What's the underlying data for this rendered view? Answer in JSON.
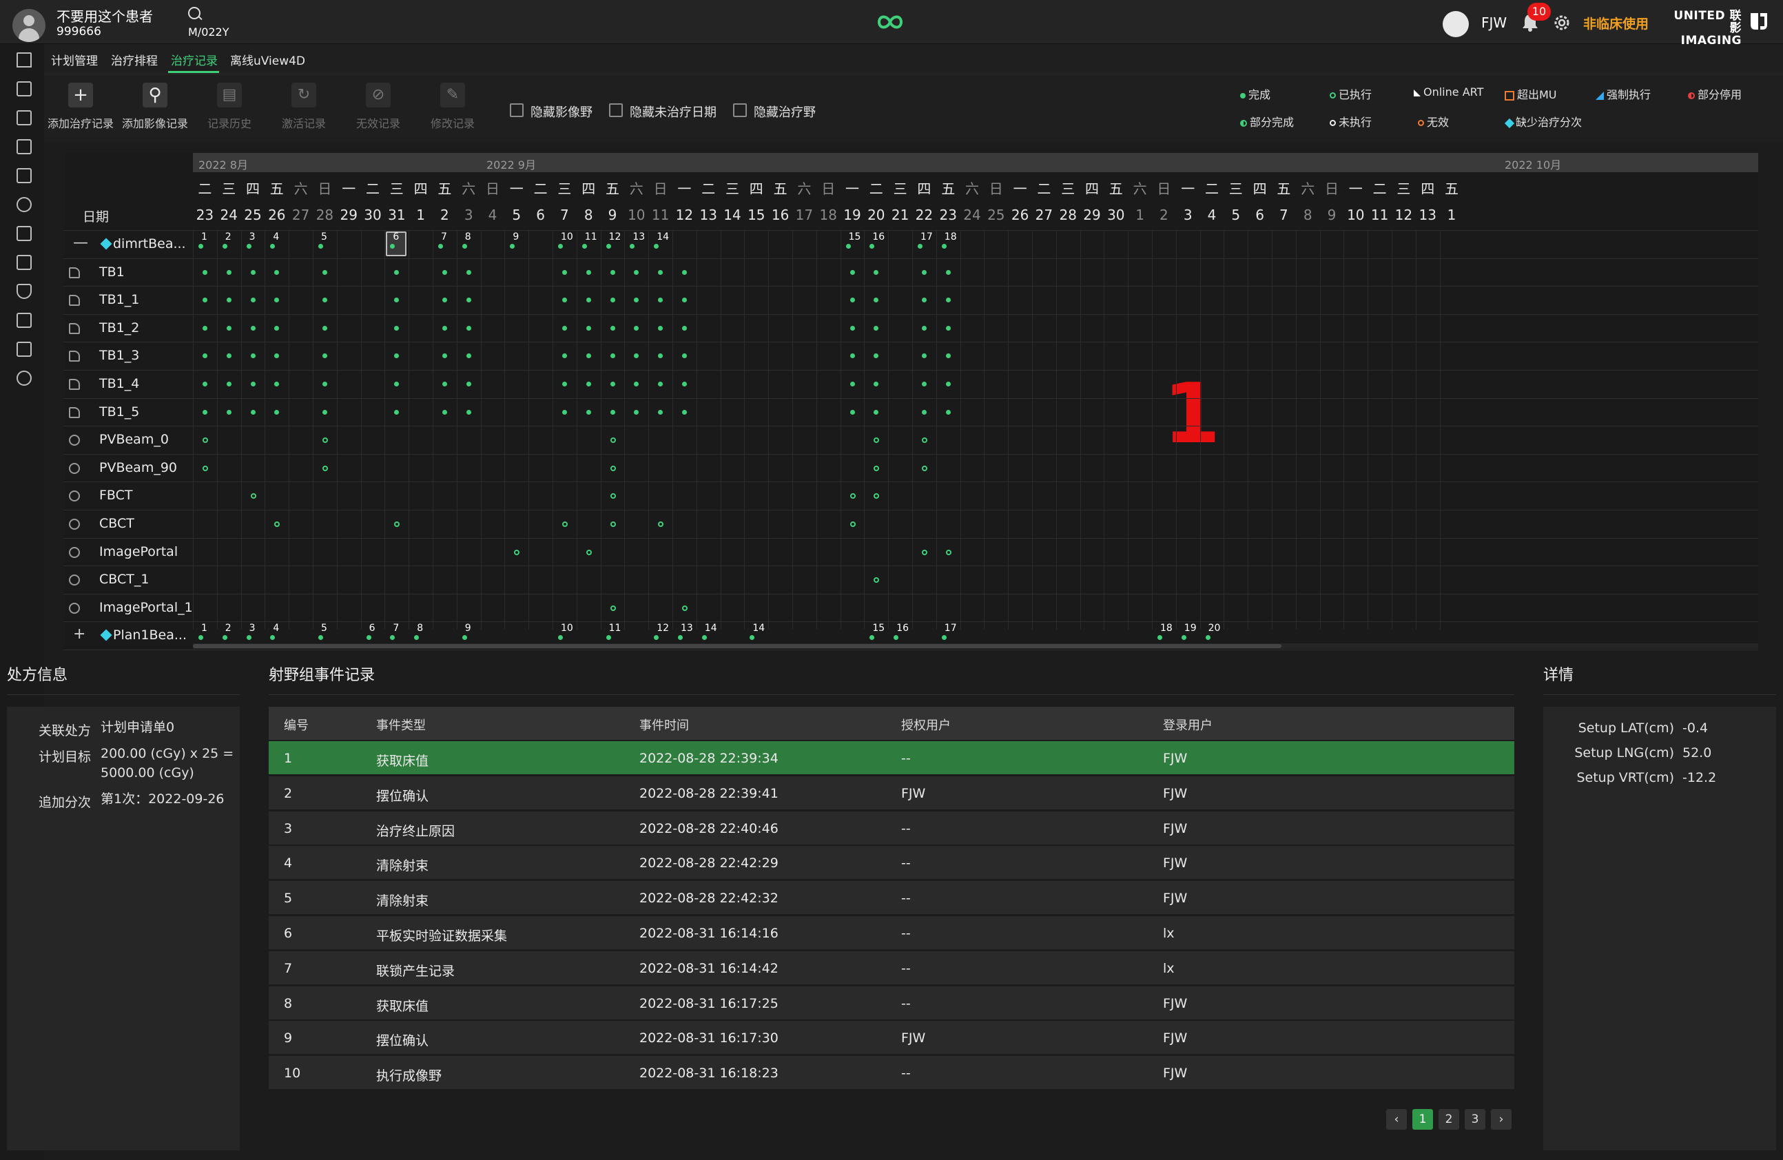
{
  "header": {
    "patient_name": "不要用这个患者",
    "patient_id": "999666",
    "patient_meta": "M/022Y",
    "user_name": "FJW",
    "notification_count": "10",
    "nonclinical_label": "非临床使用",
    "brand_line1": "UNITED 联影",
    "brand_line2": "IMAGING"
  },
  "nav_tabs": [
    {
      "label": "计划管理"
    },
    {
      "label": "治疗排程"
    },
    {
      "label": "治疗记录"
    },
    {
      "label": "离线uView4D"
    }
  ],
  "active_tab": "治疗记录",
  "toolbar": {
    "tools": [
      {
        "label": "添加治疗记录",
        "icon": "plus-icon",
        "enabled": true
      },
      {
        "label": "添加影像记录",
        "icon": "add-image-user-icon",
        "enabled": true
      },
      {
        "label": "记录历史",
        "icon": "history-icon",
        "enabled": false
      },
      {
        "label": "激活记录",
        "icon": "activate-icon",
        "enabled": false
      },
      {
        "label": "无效记录",
        "icon": "invalid-icon",
        "enabled": false
      },
      {
        "label": "修改记录",
        "icon": "edit-icon",
        "enabled": false
      }
    ],
    "checkboxes": [
      {
        "label": "隐藏影像野",
        "checked": false
      },
      {
        "label": "隐藏未治疗日期",
        "checked": false
      },
      {
        "label": "隐藏治疗野",
        "checked": false
      }
    ]
  },
  "legend": [
    {
      "label": "完成",
      "mark": "filled-dot"
    },
    {
      "label": "已执行",
      "mark": "hollow-dot"
    },
    {
      "label": "Online ART",
      "mark": "triangle-white"
    },
    {
      "label": "超出MU",
      "mark": "orange-square"
    },
    {
      "label": "强制执行",
      "mark": "blue-triangle"
    },
    {
      "label": "部分停用",
      "mark": "red-half"
    },
    {
      "label": "部分完成",
      "mark": "half-dot"
    },
    {
      "label": "未执行",
      "mark": "white-hollow"
    },
    {
      "label": "无效",
      "mark": "orange-hollow"
    },
    {
      "label": "缺少治疗分次",
      "mark": "cyan-diamond"
    }
  ],
  "grid": {
    "date_header": "日期",
    "months": [
      "2022 8月",
      "2022 9月",
      "2022 10月"
    ],
    "days": [
      {
        "wd": "二",
        "d": "23"
      },
      {
        "wd": "三",
        "d": "24"
      },
      {
        "wd": "四",
        "d": "25"
      },
      {
        "wd": "五",
        "d": "26"
      },
      {
        "wd": "六",
        "d": "27"
      },
      {
        "wd": "日",
        "d": "28"
      },
      {
        "wd": "一",
        "d": "29"
      },
      {
        "wd": "二",
        "d": "30"
      },
      {
        "wd": "三",
        "d": "31"
      },
      {
        "wd": "四",
        "d": "1"
      },
      {
        "wd": "五",
        "d": "2"
      },
      {
        "wd": "六",
        "d": "3"
      },
      {
        "wd": "日",
        "d": "4"
      },
      {
        "wd": "一",
        "d": "5"
      },
      {
        "wd": "二",
        "d": "6"
      },
      {
        "wd": "三",
        "d": "7"
      },
      {
        "wd": "四",
        "d": "8"
      },
      {
        "wd": "五",
        "d": "9"
      },
      {
        "wd": "六",
        "d": "10"
      },
      {
        "wd": "日",
        "d": "11"
      },
      {
        "wd": "一",
        "d": "12"
      },
      {
        "wd": "二",
        "d": "13"
      },
      {
        "wd": "三",
        "d": "14"
      },
      {
        "wd": "四",
        "d": "15"
      },
      {
        "wd": "五",
        "d": "16"
      },
      {
        "wd": "六",
        "d": "17"
      },
      {
        "wd": "日",
        "d": "18"
      },
      {
        "wd": "一",
        "d": "19"
      },
      {
        "wd": "二",
        "d": "20"
      },
      {
        "wd": "三",
        "d": "21"
      },
      {
        "wd": "四",
        "d": "22"
      },
      {
        "wd": "五",
        "d": "23"
      },
      {
        "wd": "六",
        "d": "24"
      },
      {
        "wd": "日",
        "d": "25"
      },
      {
        "wd": "一",
        "d": "26"
      },
      {
        "wd": "二",
        "d": "27"
      },
      {
        "wd": "三",
        "d": "28"
      },
      {
        "wd": "四",
        "d": "29"
      },
      {
        "wd": "五",
        "d": "30"
      },
      {
        "wd": "六",
        "d": "1"
      },
      {
        "wd": "日",
        "d": "2"
      },
      {
        "wd": "一",
        "d": "3"
      },
      {
        "wd": "二",
        "d": "4"
      },
      {
        "wd": "三",
        "d": "5"
      },
      {
        "wd": "四",
        "d": "6"
      },
      {
        "wd": "五",
        "d": "7"
      },
      {
        "wd": "六",
        "d": "8"
      },
      {
        "wd": "日",
        "d": "9"
      },
      {
        "wd": "一",
        "d": "10"
      },
      {
        "wd": "二",
        "d": "11"
      },
      {
        "wd": "三",
        "d": "12"
      },
      {
        "wd": "四",
        "d": "13"
      },
      {
        "wd": "五",
        "d": "1"
      }
    ],
    "rows": [
      {
        "name": "dimrtBea...",
        "kind": "group",
        "expanded": true,
        "fractions": [
          [
            0,
            "1"
          ],
          [
            1,
            "2"
          ],
          [
            2,
            "3"
          ],
          [
            3,
            "4"
          ],
          [
            5,
            "5"
          ],
          [
            8,
            "6"
          ],
          [
            10,
            "7"
          ],
          [
            11,
            "8"
          ],
          [
            13,
            "9"
          ],
          [
            15,
            "10"
          ],
          [
            16,
            "11"
          ],
          [
            17,
            "12"
          ],
          [
            18,
            "13"
          ],
          [
            19,
            "14"
          ],
          [
            27,
            "15"
          ],
          [
            28,
            "16"
          ],
          [
            30,
            "17"
          ],
          [
            31,
            "18"
          ]
        ],
        "selected_fraction": "6"
      },
      {
        "name": "TB1",
        "kind": "treat",
        "marks": [
          0,
          1,
          2,
          3,
          5,
          8,
          10,
          11,
          15,
          16,
          17,
          18,
          19,
          20,
          27,
          28,
          30,
          31
        ],
        "style": "filled"
      },
      {
        "name": "TB1_1",
        "kind": "treat",
        "marks": [
          0,
          1,
          2,
          3,
          5,
          8,
          10,
          11,
          15,
          16,
          17,
          18,
          19,
          20,
          27,
          28,
          30,
          31
        ],
        "style": "filled"
      },
      {
        "name": "TB1_2",
        "kind": "treat",
        "marks": [
          0,
          1,
          2,
          3,
          5,
          8,
          10,
          11,
          15,
          16,
          17,
          18,
          19,
          20,
          27,
          28,
          30,
          31
        ],
        "style": "filled"
      },
      {
        "name": "TB1_3",
        "kind": "treat",
        "marks": [
          0,
          1,
          2,
          3,
          5,
          8,
          10,
          11,
          15,
          16,
          17,
          18,
          19,
          20,
          27,
          28,
          30,
          31
        ],
        "style": "filled"
      },
      {
        "name": "TB1_4",
        "kind": "treat",
        "marks": [
          0,
          1,
          2,
          3,
          5,
          8,
          10,
          11,
          15,
          16,
          17,
          18,
          19,
          20,
          27,
          28,
          30,
          31
        ],
        "style": "filled"
      },
      {
        "name": "TB1_5",
        "kind": "treat",
        "marks": [
          0,
          1,
          2,
          3,
          5,
          8,
          10,
          11,
          15,
          16,
          17,
          18,
          19,
          20,
          27,
          28,
          30,
          31
        ],
        "style": "filled"
      },
      {
        "name": "PVBeam_0",
        "kind": "image",
        "marks": [
          0,
          5,
          17,
          28,
          30
        ],
        "style": "hollow"
      },
      {
        "name": "PVBeam_90",
        "kind": "image",
        "marks": [
          0,
          5,
          17,
          28,
          30
        ],
        "style": "hollow"
      },
      {
        "name": "FBCT",
        "kind": "image",
        "marks": [
          2,
          17,
          27,
          28
        ],
        "style": "hollow"
      },
      {
        "name": "CBCT",
        "kind": "image",
        "marks": [
          3,
          8,
          15,
          17,
          19,
          27
        ],
        "style": "hollow"
      },
      {
        "name": "ImagePortal",
        "kind": "image",
        "marks": [
          13,
          16,
          30,
          31
        ],
        "style": "hollow"
      },
      {
        "name": "CBCT_1",
        "kind": "image",
        "marks": [
          28
        ],
        "style": "hollow"
      },
      {
        "name": "ImagePortal_1",
        "kind": "image",
        "marks": [
          17,
          20
        ],
        "style": "hollow"
      },
      {
        "name": "Plan1Bea...",
        "kind": "group",
        "expanded": false,
        "fractions": [
          [
            0,
            "1"
          ],
          [
            1,
            "2"
          ],
          [
            2,
            "3"
          ],
          [
            3,
            "4"
          ],
          [
            5,
            "5"
          ],
          [
            7,
            "6"
          ],
          [
            8,
            "7"
          ],
          [
            9,
            "8"
          ],
          [
            11,
            "9"
          ],
          [
            15,
            "10"
          ],
          [
            17,
            "11"
          ],
          [
            19,
            "12"
          ],
          [
            20,
            "13"
          ],
          [
            21,
            "14"
          ],
          [
            23,
            "14"
          ],
          [
            28,
            "15"
          ],
          [
            29,
            "16"
          ],
          [
            31,
            "17"
          ],
          [
            40,
            "18"
          ],
          [
            41,
            "19"
          ],
          [
            42,
            "20"
          ]
        ]
      }
    ],
    "annotation": "1"
  },
  "rx_panel": {
    "title": "处方信息",
    "items": [
      {
        "key": "关联处方",
        "value": "计划申请单0"
      },
      {
        "key": "计划目标",
        "value": "200.00 (cGy) x 25 = 5000.00 (cGy)"
      },
      {
        "key": "追加分次",
        "value": "第1次：2022-09-26"
      }
    ]
  },
  "events": {
    "title": "射野组事件记录",
    "columns": [
      "编号",
      "事件类型",
      "事件时间",
      "授权用户",
      "登录用户"
    ],
    "rows": [
      [
        "1",
        "获取床值",
        "2022-08-28 22:39:34",
        "--",
        "FJW"
      ],
      [
        "2",
        "摆位确认",
        "2022-08-28 22:39:41",
        "FJW",
        "FJW"
      ],
      [
        "3",
        "治疗终止原因",
        "2022-08-28 22:40:46",
        "--",
        "FJW"
      ],
      [
        "4",
        "清除射束",
        "2022-08-28 22:42:29",
        "--",
        "FJW"
      ],
      [
        "5",
        "清除射束",
        "2022-08-28 22:42:32",
        "--",
        "FJW"
      ],
      [
        "6",
        "平板实时验证数据采集",
        "2022-08-31 16:14:16",
        "--",
        "lx"
      ],
      [
        "7",
        "联锁产生记录",
        "2022-08-31 16:14:42",
        "--",
        "lx"
      ],
      [
        "8",
        "获取床值",
        "2022-08-31 16:17:25",
        "--",
        "FJW"
      ],
      [
        "9",
        "摆位确认",
        "2022-08-31 16:17:30",
        "FJW",
        "FJW"
      ],
      [
        "10",
        "执行成像野",
        "2022-08-31 16:18:23",
        "--",
        "FJW"
      ]
    ],
    "selected_row": 0,
    "pager": {
      "prev": "‹",
      "next": "›",
      "pages": [
        "1",
        "2",
        "3"
      ],
      "current": "1"
    }
  },
  "details": {
    "title": "详情",
    "items": [
      {
        "key": "Setup LAT(cm)",
        "value": "-0.4"
      },
      {
        "key": "Setup LNG(cm)",
        "value": "52.0"
      },
      {
        "key": "Setup VRT(cm)",
        "value": "-12.2"
      }
    ]
  },
  "colors": {
    "accent_green": "#3fd07a",
    "selected_row": "#2e7c3e",
    "warning_orange": "#f0a020",
    "annotation_red": "#e81010"
  }
}
